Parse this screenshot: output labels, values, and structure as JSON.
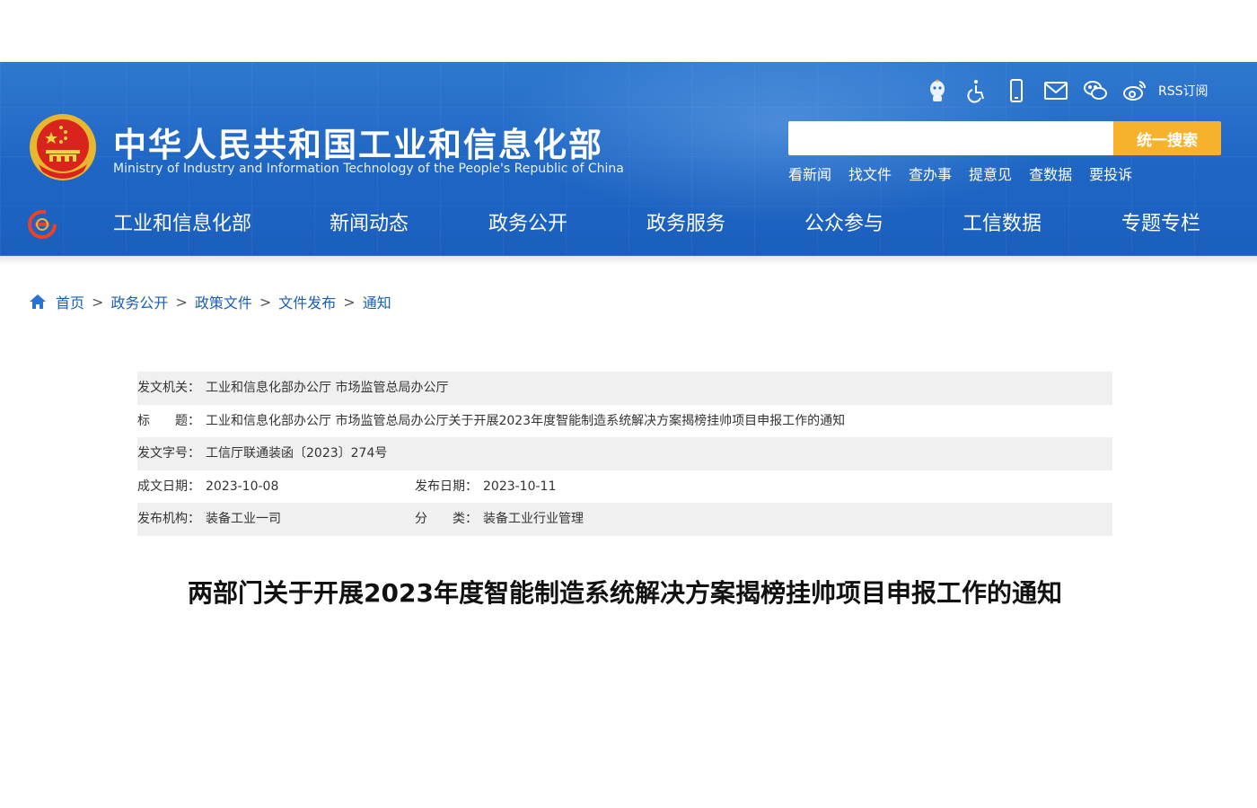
{
  "header": {
    "site_title": "中华人民共和国工业和信息化部",
    "site_subtitle": "Ministry of Industry and Information Technology of the People's Republic of China",
    "rss_label": "RSS订阅",
    "utility_icons": [
      "robot-icon",
      "accessibility-icon",
      "mobile-icon",
      "mail-icon",
      "wechat-icon",
      "weibo-icon"
    ],
    "search": {
      "placeholder": "",
      "button_label": "统一搜索"
    },
    "quick_links": [
      "看新闻",
      "找文件",
      "查办事",
      "提意见",
      "查数据",
      "要投诉"
    ],
    "colors": {
      "header_blue": "#1f66c4",
      "search_button": "#f7b12a"
    }
  },
  "nav": {
    "items": [
      "工业和信息化部",
      "新闻动态",
      "政务公开",
      "政务服务",
      "公众参与",
      "工信数据",
      "专题专栏"
    ]
  },
  "breadcrumb": {
    "items": [
      "首页",
      "政务公开",
      "政策文件",
      "文件发布",
      "通知"
    ],
    "separator": ">"
  },
  "info": {
    "issuer_label": "发文机关：",
    "issuer_value": "工业和信息化部办公厅 市场监管总局办公厅",
    "title_label": "标　　题：",
    "title_value": "工业和信息化部办公厅 市场监管总局办公厅关于开展2023年度智能制造系统解决方案揭榜挂帅项目申报工作的通知",
    "doc_no_label": "发文字号：",
    "doc_no_value": "工信厅联通装函〔2023〕274号",
    "written_date_label": "成文日期：",
    "written_date_value": "2023-10-08",
    "publish_date_label": "发布日期：",
    "publish_date_value": "2023-10-11",
    "publisher_label": "发布机构：",
    "publisher_value": "装备工业一司",
    "category_label": "分　　类：",
    "category_value": "装备工业行业管理"
  },
  "article": {
    "title": "两部门关于开展2023年度智能制造系统解决方案揭榜挂帅项目申报工作的通知"
  }
}
